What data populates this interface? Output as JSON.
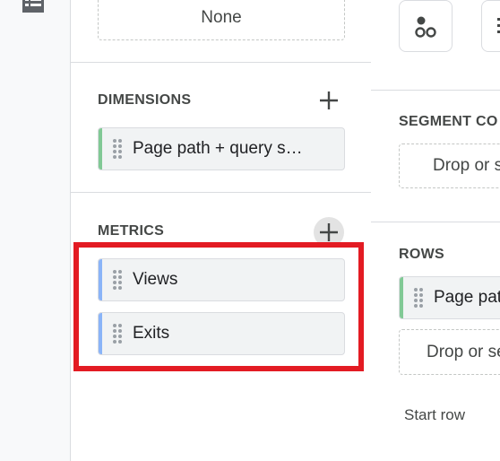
{
  "mid": {
    "none_label": "None",
    "dimensions_title": "DIMENSIONS",
    "dimension_chips": [
      {
        "label": "Page path + query s…",
        "color": "#81c995"
      }
    ],
    "metrics_title": "METRICS",
    "metric_chips": [
      {
        "label": "Views",
        "color": "#8ab4f8"
      },
      {
        "label": "Exits",
        "color": "#8ab4f8"
      }
    ]
  },
  "right": {
    "segment_title": "SEGMENT CO",
    "segment_drop": "Drop or s",
    "rows_title": "ROWS",
    "row_chip": {
      "label": "Page pat",
      "color": "#81c995"
    },
    "rows_drop": "Drop or se",
    "start_row_label": "Start row"
  },
  "colors": {
    "highlight": "#e31b23",
    "dimension_accent": "#81c995",
    "metric_accent": "#8ab4f8"
  }
}
